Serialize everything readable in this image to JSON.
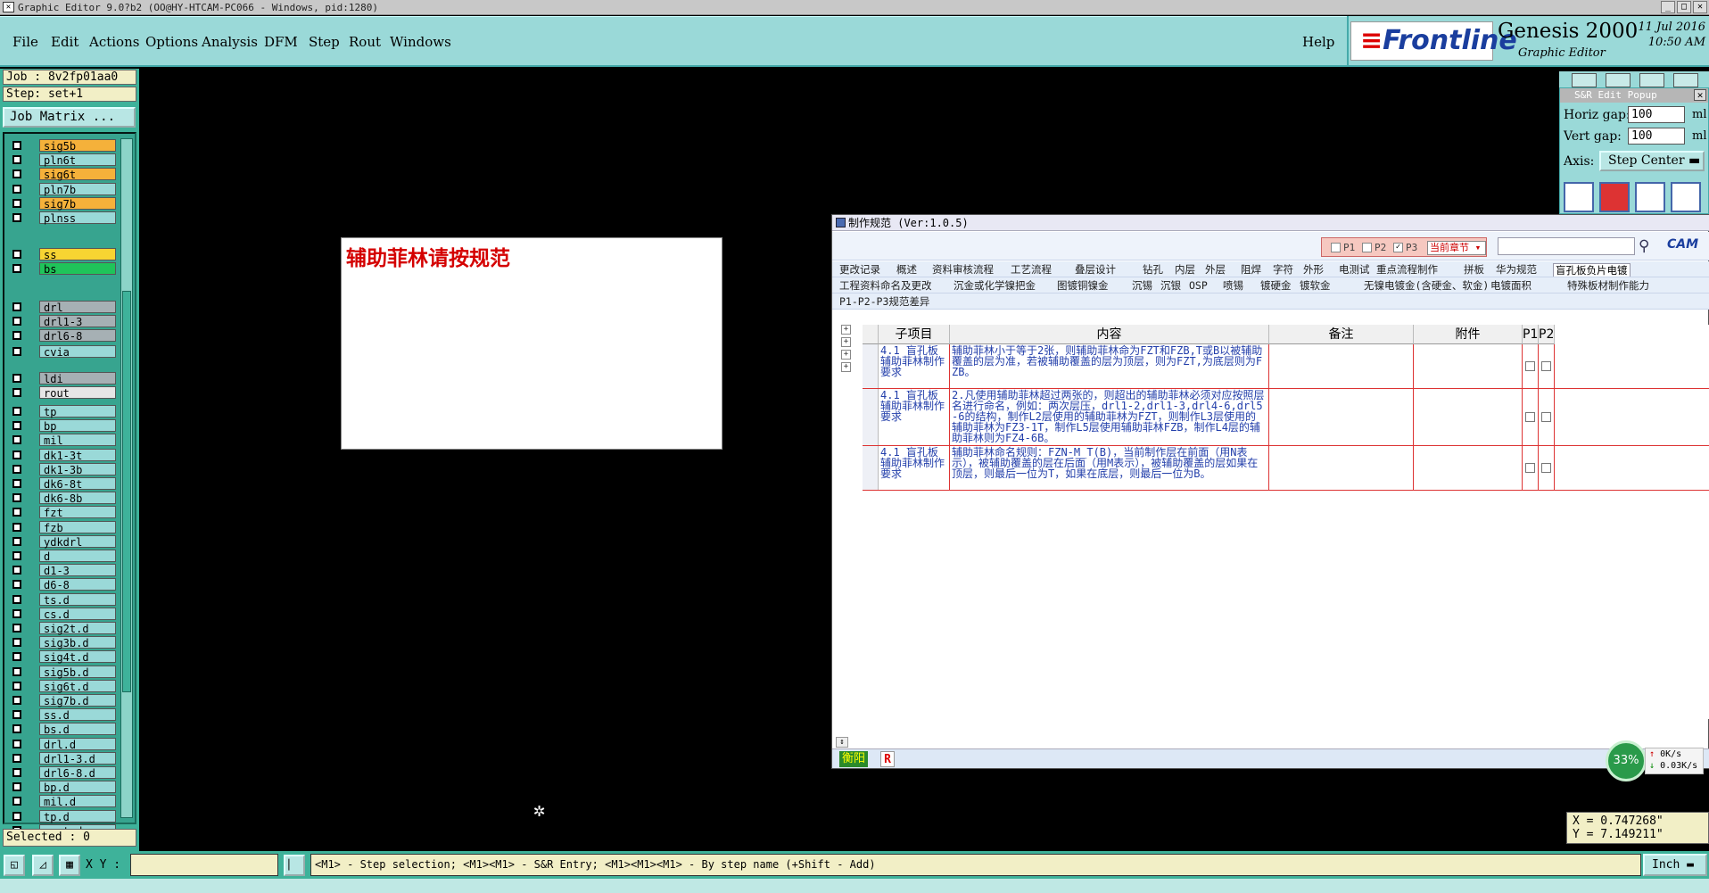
{
  "window": {
    "title": "Graphic Editor 9.0?b2 (OO@HY-HTCAM-PC066 - Windows, pid:1280)"
  },
  "menu": [
    "File",
    "Edit",
    "Actions",
    "Options",
    "Analysis",
    "DFM",
    "Step",
    "Rout",
    "Windows"
  ],
  "help_label": "Help",
  "brand": {
    "logo": "Frontline",
    "product": "Genesis 2000",
    "subtitle": "Graphic Editor",
    "date": "11 Jul 2016",
    "time": "10:50 AM"
  },
  "job": {
    "job_line": "Job : 8v2fp01aa0",
    "step_line": "Step: set+1",
    "matrix_button": "Job Matrix ..."
  },
  "layers": [
    {
      "name": "sig5b",
      "color": "#f5b13a"
    },
    {
      "name": "pln6t",
      "color": "#9ad9d8"
    },
    {
      "name": "sig6t",
      "color": "#f5b13a"
    },
    {
      "name": "pln7b",
      "color": "#9ad9d8"
    },
    {
      "name": "sig7b",
      "color": "#f5b13a"
    },
    {
      "name": "plnss",
      "color": "#9ad9d8"
    },
    {
      "name": "ss",
      "color": "#f7d432"
    },
    {
      "name": "bs",
      "color": "#1fc45a"
    },
    {
      "name": "drl",
      "color": "#a6b0b4"
    },
    {
      "name": "drl1-3",
      "color": "#a6b0b4"
    },
    {
      "name": "drl6-8",
      "color": "#a6b0b4"
    },
    {
      "name": "cvia",
      "color": "#9ad9d8"
    },
    {
      "name": "ldi",
      "color": "#a6b0b4"
    },
    {
      "name": "rout",
      "color": "#e6e6e6"
    },
    {
      "name": "tp",
      "color": "#9ad9d8"
    },
    {
      "name": "bp",
      "color": "#9ad9d8"
    },
    {
      "name": "mil",
      "color": "#9ad9d8"
    },
    {
      "name": "dk1-3t",
      "color": "#9ad9d8"
    },
    {
      "name": "dk1-3b",
      "color": "#9ad9d8"
    },
    {
      "name": "dk6-8t",
      "color": "#9ad9d8"
    },
    {
      "name": "dk6-8b",
      "color": "#9ad9d8"
    },
    {
      "name": "fzt",
      "color": "#9ad9d8"
    },
    {
      "name": "fzb",
      "color": "#9ad9d8"
    },
    {
      "name": "ydkdrl",
      "color": "#9ad9d8"
    },
    {
      "name": "d",
      "color": "#9ad9d8"
    },
    {
      "name": "d1-3",
      "color": "#9ad9d8"
    },
    {
      "name": "d6-8",
      "color": "#9ad9d8"
    },
    {
      "name": "ts.d",
      "color": "#9ad9d8"
    },
    {
      "name": "cs.d",
      "color": "#9ad9d8"
    },
    {
      "name": "sig2t.d",
      "color": "#9ad9d8"
    },
    {
      "name": "sig3b.d",
      "color": "#9ad9d8"
    },
    {
      "name": "sig4t.d",
      "color": "#9ad9d8"
    },
    {
      "name": "sig5b.d",
      "color": "#9ad9d8"
    },
    {
      "name": "sig6t.d",
      "color": "#9ad9d8"
    },
    {
      "name": "sig7b.d",
      "color": "#9ad9d8"
    },
    {
      "name": "ss.d",
      "color": "#9ad9d8"
    },
    {
      "name": "bs.d",
      "color": "#9ad9d8"
    },
    {
      "name": "drl.d",
      "color": "#9ad9d8"
    },
    {
      "name": "drl1-3.d",
      "color": "#9ad9d8"
    },
    {
      "name": "drl6-8.d",
      "color": "#9ad9d8"
    },
    {
      "name": "bp.d",
      "color": "#9ad9d8"
    },
    {
      "name": "mil.d",
      "color": "#9ad9d8"
    },
    {
      "name": "tp.d",
      "color": "#9ad9d8"
    },
    {
      "name": "rout.d",
      "color": "#9ad9d8"
    }
  ],
  "selected_label": "Selected : 0",
  "canvas_text": "辅助菲林请按规范",
  "sr_popup": {
    "title": "S&R Edit Popup",
    "horiz_label": "Horiz gap:",
    "horiz_value": "100",
    "vert_label": "Vert  gap:",
    "vert_value": "100",
    "unit": "ml",
    "axis_label": "Axis:",
    "axis_value": "Step Center"
  },
  "spec_window": {
    "title": "制作规范 (Ver:1.0.5)",
    "filters": {
      "p1": "P1",
      "p2": "P2",
      "p3": "P3",
      "chapter": "当前章节"
    },
    "brand": "CAM",
    "tabs_row1": [
      "更改记录",
      "概述",
      "资料审核流程",
      "工艺流程",
      "叠层设计",
      "钻孔",
      "内层",
      "外层",
      "阻焊",
      "字符",
      "外形",
      "电测试",
      "重点流程制作",
      "拼板",
      "华为规范",
      "盲孔板负片电镀"
    ],
    "tabs_row2": [
      "工程资料命名及更改",
      "沉金或化学镍把金",
      "图镀铜镍金",
      "沉锡",
      "沉银",
      "OSP",
      "喷锡",
      "镀硬金",
      "镀软金",
      "无镍电镀金(含硬金、软金)",
      "电镀面积",
      "特殊板材制作能力"
    ],
    "tabs_row3": [
      "P1-P2-P3规范差异"
    ],
    "columns": [
      "子项目",
      "内容",
      "备注",
      "附件",
      "P1",
      "P2"
    ],
    "rows": [
      {
        "sub": "4.1 盲孔板辅助菲林制作要求",
        "content": "辅助菲林小于等于2张，则辅助菲林命为FZT和FZB,T或B以被辅助覆盖的层为准，若被辅助覆盖的层为顶层，则为FZT,为底层则为FZB。",
        "note": "",
        "attach": ""
      },
      {
        "sub": "4.1 盲孔板辅助菲林制作要求",
        "content": "2.凡使用辅助菲林超过两张的，则超出的辅助菲林必须对应按照层名进行命名，例如：两次层压，drl1-2,drl1-3,drl4-6,drl5-6的结构，制作L2层使用的辅助菲林为FZT，则制作L3层使用的辅助菲林为FZ3-1T，制作L5层使用辅助菲林FZB，制作L4层的辅助菲林则为FZ4-6B。",
        "note": "",
        "attach": ""
      },
      {
        "sub": "4.1 盲孔板辅助菲林制作要求",
        "content": "辅助菲林命名规则：FZN-M_T(B)，当前制作层在前面（用N表示），被辅助覆盖的层在后面（用M表示），被辅助覆盖的层如果在顶层，则最后一位为T，如果在底层，则最后一位为B。",
        "note": "",
        "attach": ""
      }
    ],
    "footer_tag": "衡阳",
    "footer_r": "R"
  },
  "net": {
    "percent": "33%",
    "up": "0K/s",
    "down": "0.03K/s"
  },
  "coords": {
    "x": "X = 0.747268\"",
    "y": "Y = 7.149211\""
  },
  "bottom": {
    "xy_label": "X Y :",
    "xy_value": "",
    "status": "<M1> - Step selection; <M1><M1> - S&R Entry; <M1><M1><M1> - By step name (+Shift - Add)",
    "units": "Inch"
  }
}
